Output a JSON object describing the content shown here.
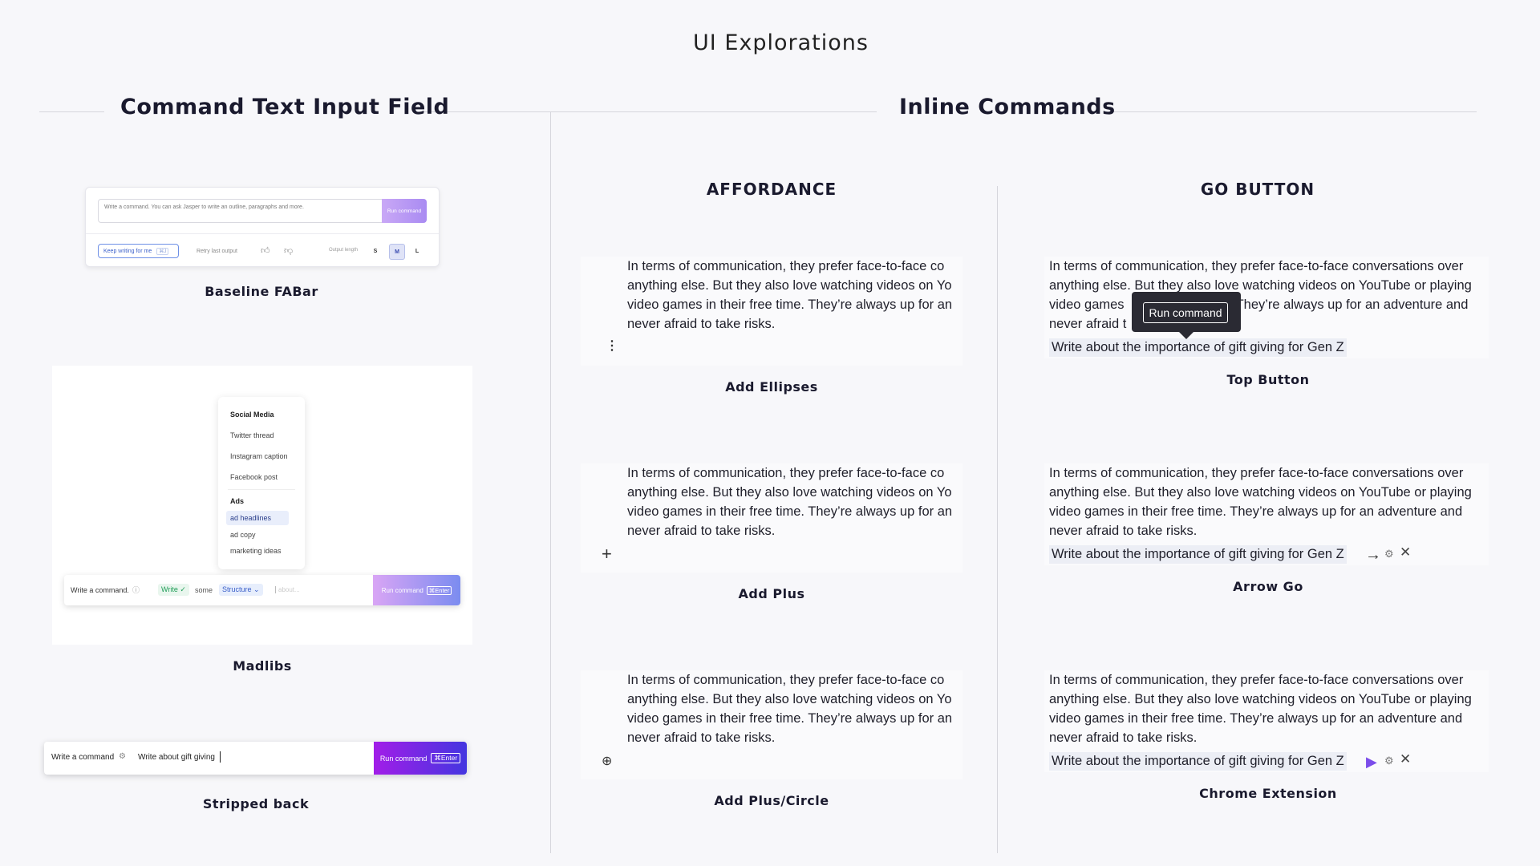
{
  "page_title": "UI Explorations",
  "left_section": {
    "title": "Command Text Input Field",
    "baseline": {
      "caption": "Baseline FABar",
      "input_placeholder": "Write a command. You can ask Jasper to write an outline, paragraphs and more.",
      "run_label": "Run command",
      "keep_writing": "Keep writing for me",
      "keep_shortcut": "⌘J",
      "retry": "Retry last output",
      "output_length": "Output length",
      "sizes": [
        "S",
        "M",
        "L"
      ],
      "selected_size": "M"
    },
    "madlibs": {
      "caption": "Madlibs",
      "menu": {
        "group1": "Social Media",
        "group1_items": [
          "Twitter thread",
          "Instagram caption",
          "Facebook post"
        ],
        "group2": "Ads",
        "group2_items": [
          "ad headlines",
          "ad copy",
          "marketing ideas"
        ],
        "selected_item": "ad headlines"
      },
      "label": "Write a command.",
      "write_chip": "Write",
      "some_text": "some",
      "structure_chip": "Structure",
      "about_placeholder": "about...",
      "run_label": "Run command",
      "shortcut": "⌘Enter"
    },
    "stripped": {
      "caption": "Stripped back",
      "label": "Write a command",
      "input_value": "Write about gift giving",
      "run_label": "Run command",
      "shortcut": "⌘Enter"
    }
  },
  "right_section": {
    "title": "Inline Commands",
    "affordance": {
      "title": "AFFORDANCE",
      "paragraph_lines": [
        "In terms of communication, they prefer face-to-face co",
        "anything else. But they also love watching videos on Yo",
        "video games in their free time. They’re always up for an",
        "never afraid to take risks."
      ],
      "variants": [
        {
          "caption": "Add Ellipses",
          "icon": "ellipsis-vertical-icon"
        },
        {
          "caption": "Add Plus",
          "icon": "plus-icon"
        },
        {
          "caption": "Add Plus/Circle",
          "icon": "plus-circle-icon"
        }
      ]
    },
    "go_button": {
      "title": "GO BUTTON",
      "paragraph_lines": [
        "In terms of communication, they prefer face-to-face conversations over",
        "anything else. But they also love watching videos on YouTube or playing",
        "video games in their free time. They’re always up for an adventure and",
        "never afraid to take risks."
      ],
      "top_lines": [
        "In terms of communication, they prefer face-to-face conversations over",
        "anything else. But they also love watching videos on YouTube or playing",
        "video games",
        "They’re always up for an adventure and",
        "never afraid t"
      ],
      "command_text": "Write about the importance of gift giving for Gen Z",
      "tooltip": "Run command",
      "variants": [
        {
          "caption": "Top Button"
        },
        {
          "caption": "Arrow Go"
        },
        {
          "caption": "Chrome Extension"
        }
      ]
    }
  }
}
